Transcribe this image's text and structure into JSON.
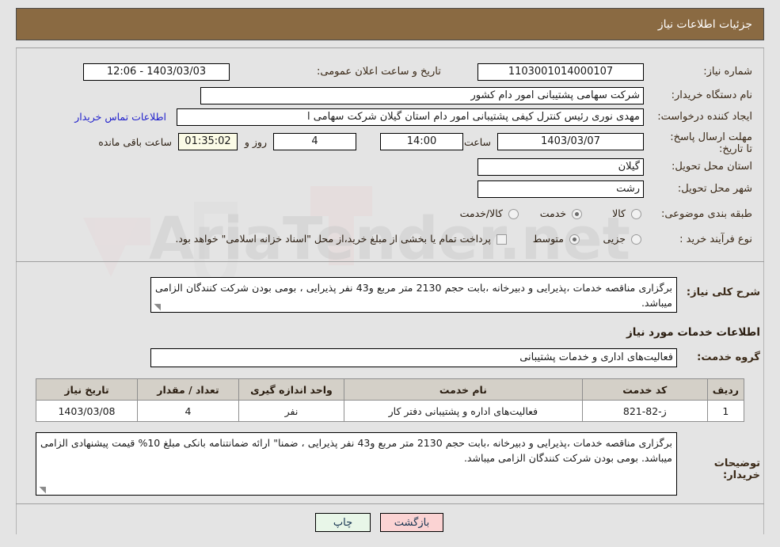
{
  "header": {
    "title": "جزئیات اطلاعات نیاز"
  },
  "form": {
    "need_number_label": "شماره نیاز:",
    "need_number_value": "1103001014000107",
    "announce_label": "تاریخ و ساعت اعلان عمومی:",
    "announce_value": "1403/03/03 - 12:06",
    "buyer_org_label": "نام دستگاه خریدار:",
    "buyer_org_value": "شرکت سهامی پشتیبانی امور دام کشور",
    "creator_label": "ایجاد کننده درخواست:",
    "creator_value": "مهدی نوری رئیس کنترل کیفی پشتیبانی امور دام استان گیلان شرکت سهامی ا",
    "contact_link": "اطلاعات تماس خریدار",
    "deadline_label": "مهلت ارسال پاسخ: تا تاریخ:",
    "deadline_date": "1403/03/07",
    "deadline_time_label": "ساعت",
    "deadline_time": "14:00",
    "remaining_days": "4",
    "remaining_days_label": "روز و",
    "remaining_clock": "01:35:02",
    "remaining_clock_label": "ساعت باقی مانده",
    "province_label": "استان محل تحویل:",
    "province_value": "گیلان",
    "city_label": "شهر محل تحویل:",
    "city_value": "رشت",
    "category_label": "طبقه بندی موضوعی:",
    "category_options": [
      {
        "label": "کالا",
        "selected": false
      },
      {
        "label": "خدمت",
        "selected": true
      },
      {
        "label": "کالا/خدمت",
        "selected": false
      }
    ],
    "process_label": "نوع فرآیند خرید :",
    "process_options": [
      {
        "label": "جزیی",
        "selected": false
      },
      {
        "label": "متوسط",
        "selected": true
      }
    ],
    "treasury_checkbox_label": "پرداخت تمام یا بخشی از مبلغ خرید،از محل \"اسناد خزانه اسلامی\" خواهد بود.",
    "treasury_checked": false,
    "general_desc_label": "شرح کلی نیاز:",
    "general_desc_value": "برگزاری مناقصه خدمات ،پذیرایی و دبیرخانه ،بابت حجم 2130 متر مربع و43 نفر پذیرایی ، بومی بودن شرکت کنندگان الزامی میباشد.",
    "services_section_title": "اطلاعات خدمات مورد نیاز",
    "service_group_label": "گروه خدمت:",
    "service_group_value": "فعالیت‌های اداری و خدمات پشتیبانی",
    "buyer_notes_label": "توضیحات خریدار:",
    "buyer_notes_value": "برگزاری مناقصه خدمات ،پذیرایی و دبیرخانه ،بابت حجم 2130 متر مربع و43 نفر پذیرایی ، ضمنا\" ارائه ضمانتنامه بانکی مبلغ 10% قیمت پیشنهادی الزامی میباشد. بومی بودن شرکت کنندگان الزامی میباشد."
  },
  "table": {
    "headers": [
      "ردیف",
      "کد خدمت",
      "نام خدمت",
      "واحد اندازه گیری",
      "تعداد / مقدار",
      "تاریخ نیاز"
    ],
    "rows": [
      {
        "row_no": "1",
        "service_code": "ز-82-821",
        "service_name": "فعالیت‌های اداره و پشتیبانی دفتر کار",
        "unit": "نفر",
        "quantity": "4",
        "need_date": "1403/03/08"
      }
    ]
  },
  "buttons": {
    "print": "چاپ",
    "back": "بازگشت"
  },
  "watermark": {
    "text": "AriaTender.net"
  },
  "colors": {
    "header_bar": "#8a6a42",
    "page_bg": "#e4e4e4",
    "link": "#2222cc",
    "print_btn": "#e8f6e8",
    "back_btn": "#fbd3d3",
    "clock_field": "#fbfbe6"
  }
}
